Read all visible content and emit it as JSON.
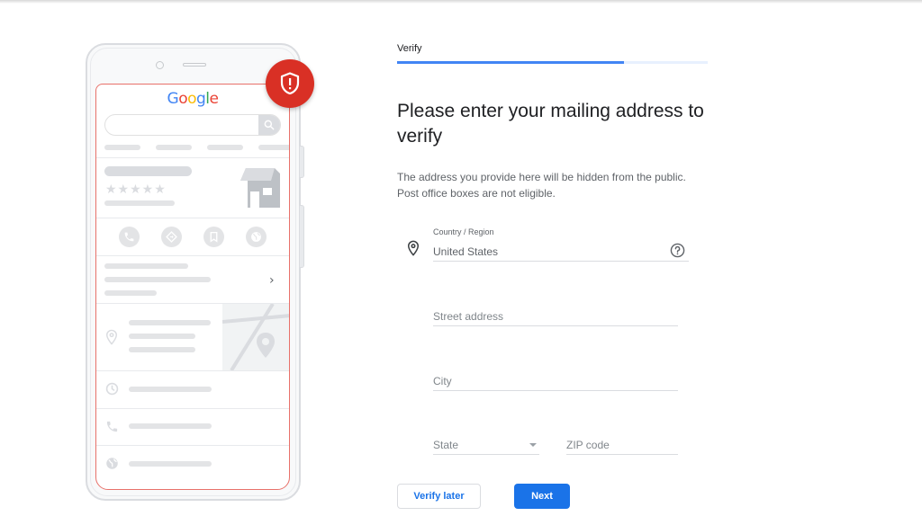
{
  "phone_illustration": {
    "logo_letters": [
      "G",
      "o",
      "o",
      "g",
      "l",
      "e"
    ],
    "stars": "★★★★★",
    "chevron": "›",
    "badge_icon": "shield-alert-icon"
  },
  "stepper": {
    "step_label": "Verify",
    "progress_percent": 73
  },
  "form": {
    "title": "Please enter your mailing address to verify",
    "description": "The address you provide here will be hidden from the public. Post office boxes are not eligible.",
    "country": {
      "label": "Country / Region",
      "value": "United States",
      "icon": "location-pin-icon",
      "help_icon": "help-circle-icon"
    },
    "street": {
      "placeholder": "Street address",
      "value": ""
    },
    "city": {
      "placeholder": "City",
      "value": ""
    },
    "state": {
      "placeholder": "State",
      "value": ""
    },
    "zip": {
      "placeholder": "ZIP code",
      "value": ""
    }
  },
  "actions": {
    "verify_later_label": "Verify later",
    "next_label": "Next"
  },
  "colors": {
    "primary": "#1a73e8",
    "progress": "#4285f4",
    "alert": "#d93025",
    "screen_outline": "#e8716a"
  }
}
